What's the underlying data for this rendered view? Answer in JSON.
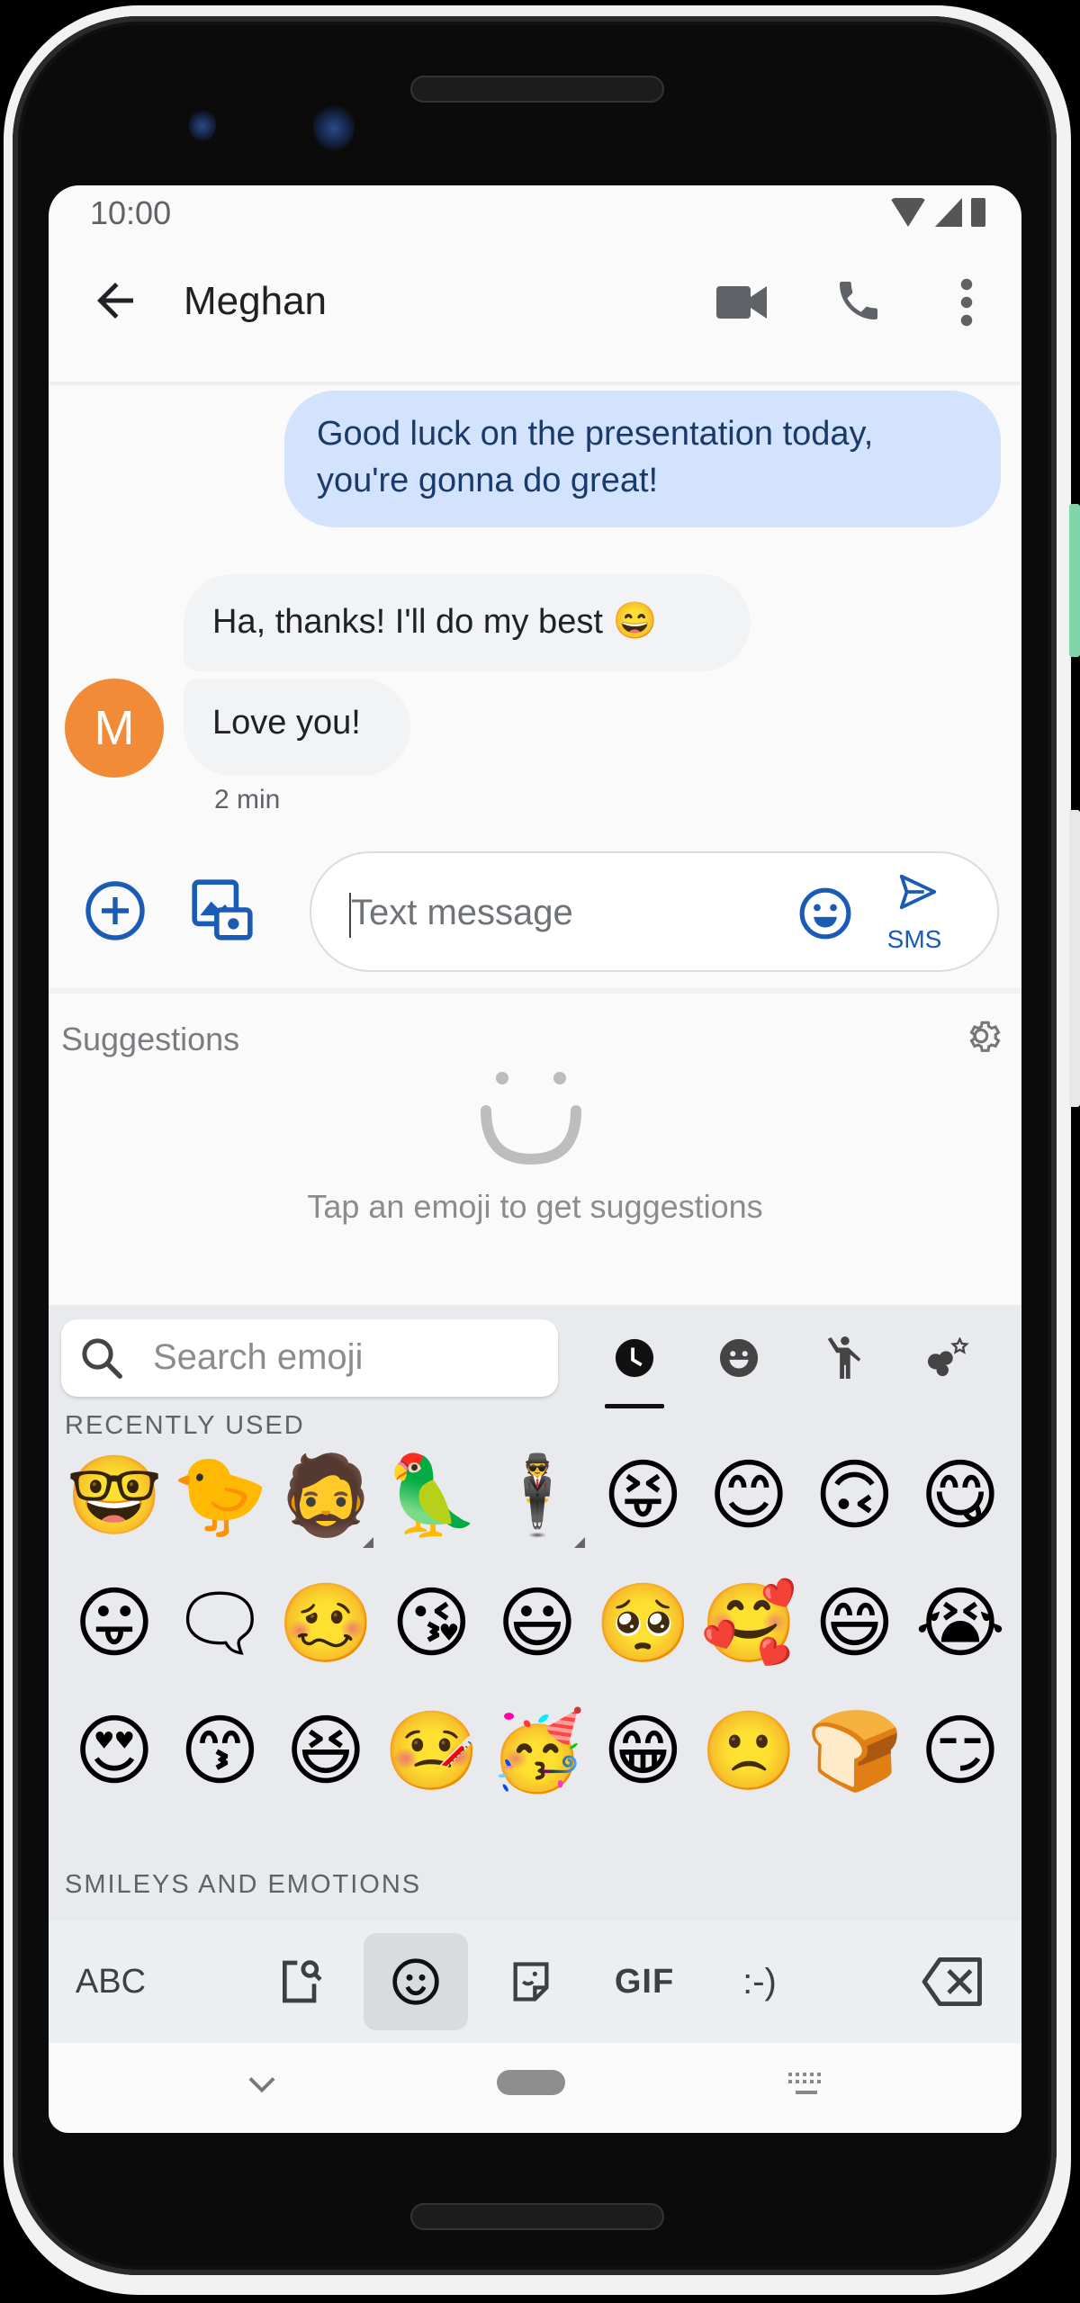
{
  "status_bar": {
    "time": "10:00"
  },
  "app_bar": {
    "title": "Meghan"
  },
  "conversation": {
    "sent": [
      {
        "text": "Good luck on the presentation today, you're gonna do great!"
      }
    ],
    "received": [
      {
        "text": "Ha, thanks! I'll do my best",
        "emoji": "😄"
      },
      {
        "text": "Love you!"
      }
    ],
    "contact_initial": "M",
    "timestamp": "2 min"
  },
  "compose": {
    "placeholder": "Text message",
    "send_label": "SMS"
  },
  "suggestions": {
    "title": "Suggestions",
    "hint": "Tap an emoji to get suggestions"
  },
  "emoji_keyboard": {
    "search_placeholder": "Search emoji",
    "categories": [
      "recent-clock",
      "smileys",
      "people",
      "animals-nature",
      "food-drink"
    ],
    "active_category": "recent-clock",
    "sections": {
      "recent": "RECENTLY USED",
      "smileys": "SMILEYS AND EMOTIONS"
    },
    "recent_rows": [
      [
        "🤓",
        "🐤",
        "🧔",
        "🦜",
        "🕴",
        "😝",
        "😊",
        "🙃",
        "😋"
      ],
      [
        "😛",
        "🗨",
        "🥴",
        "😘",
        "😃",
        "🥺",
        "🥰",
        "😄",
        "😭"
      ],
      [
        "😍",
        "😙",
        "😆",
        "🤒",
        "🥳",
        "😁",
        "🙁",
        "🍞",
        "😏"
      ]
    ],
    "variant_cells": [
      [
        0,
        2
      ],
      [
        0,
        4
      ]
    ]
  },
  "keyboard_bar": {
    "abc": "ABC",
    "gif": "GIF",
    "emoticon": ":-)",
    "active": "emoji"
  },
  "colors": {
    "accent": "#1a73e8",
    "sent_bubble": "#d3e3fd",
    "received_bubble": "#f1f3f4",
    "avatar": "#f28b37",
    "keyboard_bg": "#e8eaed"
  }
}
